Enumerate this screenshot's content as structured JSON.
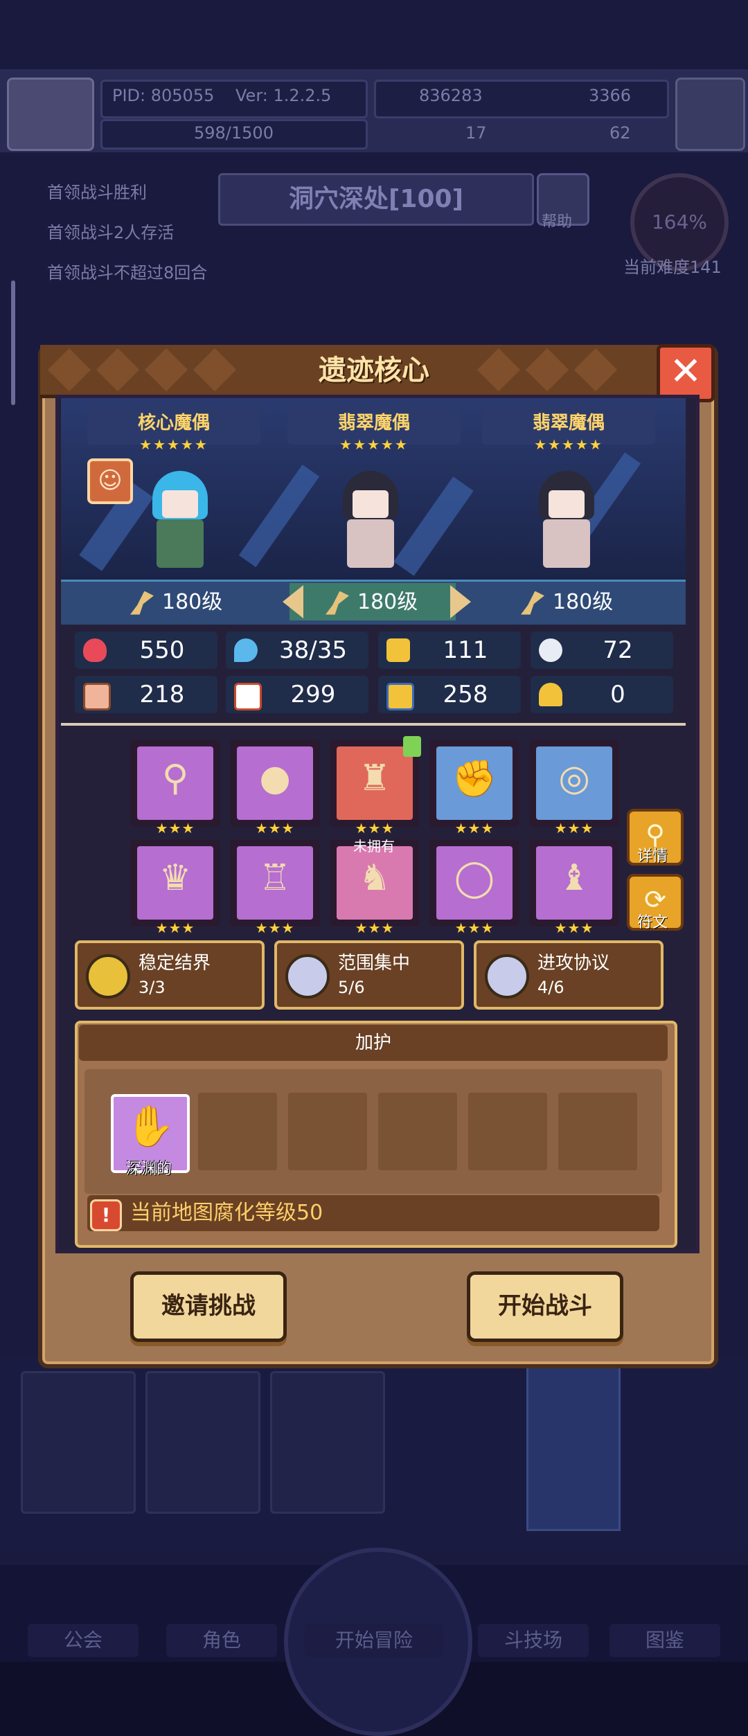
{
  "background": {
    "pid_label": "PID: 805055",
    "version": "Ver: 1.2.2.5",
    "currency_1": "836283",
    "currency_2": "3366",
    "exp": "598/1500",
    "currency_3": "17",
    "currency_4": "62",
    "quests": [
      "首领战斗胜利",
      "首领战斗2人存活",
      "首领战斗不超过8回合"
    ],
    "stage_name": "洞穴深处[100]",
    "help_label": "帮助",
    "difficulty_percent": "164%",
    "difficulty_label": "当前难度141",
    "nav": [
      "公会",
      "角色",
      "开始冒险",
      "斗技场",
      "图鉴"
    ]
  },
  "modal": {
    "title": "遗迹核心",
    "close_icon": "close-icon",
    "characters": [
      {
        "name": "核心魔偶",
        "stars": "★★★★★"
      },
      {
        "name": "翡翠魔偶",
        "stars": "★★★★★"
      },
      {
        "name": "翡翠魔偶",
        "stars": "★★★★★"
      }
    ],
    "levels": [
      "180级",
      "180级",
      "180级"
    ],
    "stats": [
      {
        "icon": "heart-icon",
        "value": "550"
      },
      {
        "icon": "mana-drop-icon",
        "value": "38/35"
      },
      {
        "icon": "shield-icon",
        "value": "111"
      },
      {
        "icon": "wing-icon",
        "value": "72"
      },
      {
        "icon": "fist-icon",
        "value": "218"
      },
      {
        "icon": "book-icon",
        "value": "299"
      },
      {
        "icon": "boot-icon",
        "value": "258"
      },
      {
        "icon": "horseshoe-icon",
        "value": "0"
      }
    ],
    "equipment": [
      {
        "icon": "staff-icon",
        "stars": "★★★"
      },
      {
        "icon": "orb-icon",
        "stars": "★★★"
      },
      {
        "icon": "vest-icon",
        "stars": "★★★"
      },
      {
        "icon": "gauntlet-icon",
        "stars": "★★★"
      },
      {
        "icon": "ring-icon",
        "stars": "★★★"
      },
      {
        "icon": "helmet-icon",
        "stars": "★★★"
      },
      {
        "icon": "robe-icon",
        "stars": "★★★"
      },
      {
        "icon": "boot-icon",
        "stars": "★★★"
      },
      {
        "icon": "bracelet-icon",
        "stars": "★★★"
      },
      {
        "icon": "boots-icon",
        "stars": "★★★"
      }
    ],
    "unowned_label": "未拥有",
    "detail_label": "详情",
    "rune_label": "符文",
    "sets": [
      {
        "name": "稳定结界",
        "progress": "3/3"
      },
      {
        "name": "范围集中",
        "progress": "5/6"
      },
      {
        "name": "进攻协议",
        "progress": "4/6"
      }
    ],
    "blessing_title": "加护",
    "blessing_slot_label": "深渊的",
    "warning_text": "当前地图腐化等级50",
    "invite_button": "邀请挑战",
    "start_button": "开始战斗",
    "colors": {
      "accent_gold": "#ffd23a",
      "frame_brown": "#6a4124",
      "close_red": "#e85a42",
      "warning_text": "#ffcf6a"
    }
  }
}
